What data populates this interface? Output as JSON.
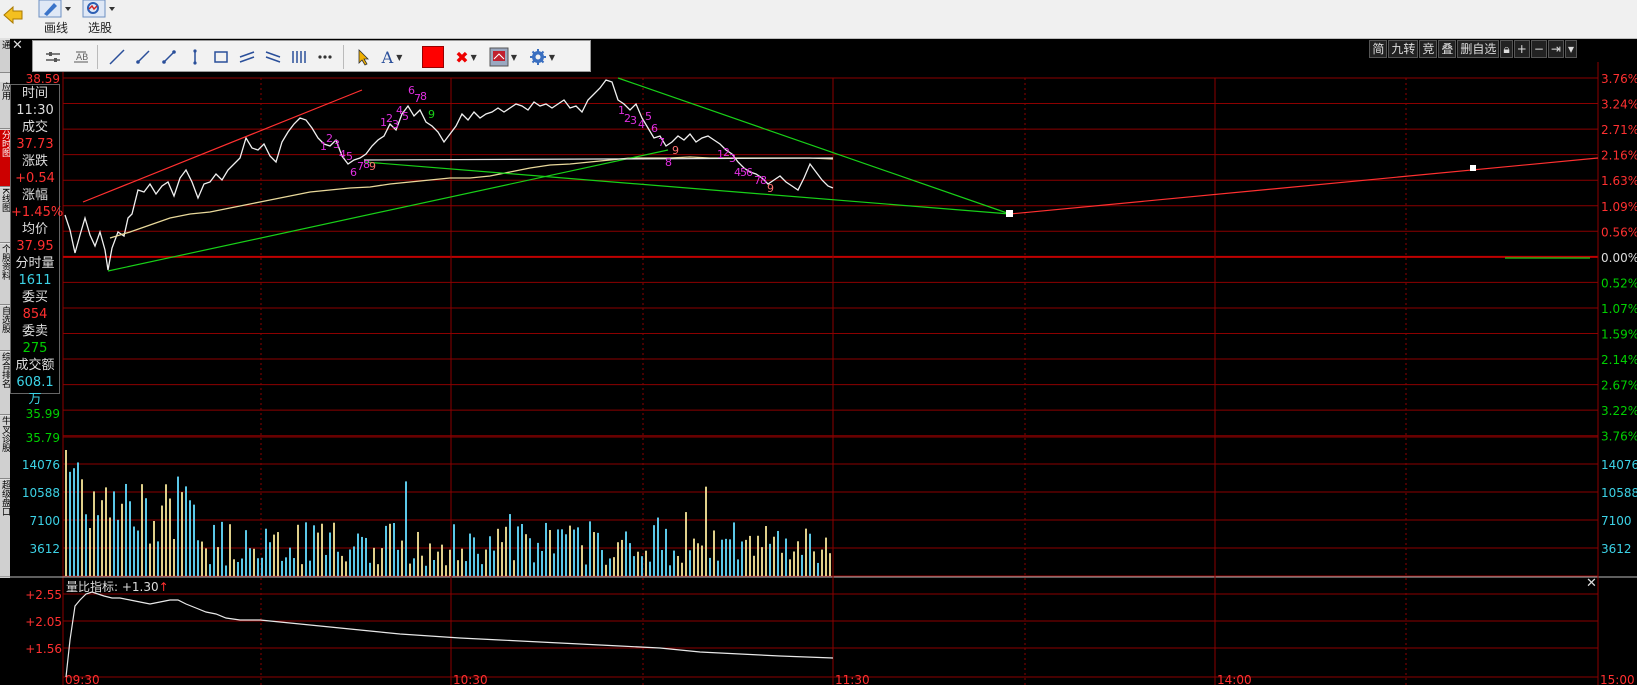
{
  "toolbar": {
    "draw_line_label": "画线",
    "stock_select_label": "选股"
  },
  "side_tabs": [
    "通",
    "应用",
    "分时图",
    "K线图",
    "个股资料",
    "自选股",
    "综合排名",
    "牛叉诊股",
    "超级盘口"
  ],
  "draw_tools": [
    "settings-icon",
    "text-style-icon",
    "line-icon",
    "ray-icon",
    "arrow-line-icon",
    "vertical-line-icon",
    "rectangle-icon",
    "parallel-lines-icon",
    "channel-icon",
    "fibonacci-icon",
    "more-icon",
    "pointer-icon",
    "text-icon",
    "color-swatch",
    "delete-icon",
    "display-icon",
    "gear-icon"
  ],
  "draw_tool_text": "A",
  "right_buttons": [
    "简",
    "九转",
    "竞",
    "叠",
    "删自选"
  ],
  "info_panel": {
    "time_label": "时间",
    "time_value": "11:30",
    "price_label": "成交",
    "price_value": "37.73",
    "change_label": "涨跌",
    "change_value": "+0.54",
    "change_pct_label": "涨幅",
    "change_pct_value": "+1.45%",
    "avg_label": "均价",
    "avg_value": "37.95",
    "minute_vol_label": "分时量",
    "minute_vol_value": "1611",
    "bid_label": "委买",
    "bid_value": "854",
    "ask_label": "委卖",
    "ask_value": "275",
    "amount_label": "成交额",
    "amount_value": "608.1万"
  },
  "indicator": {
    "label": "量比指标: +1.30",
    "arrow": "↑"
  },
  "colors": {
    "up": "#ff3030",
    "down": "#00d000",
    "grid": "#8b0000",
    "volume_blue": "#5bc8e8",
    "volume_yellow": "#e0d08a",
    "info_cyan": "#3cd2e6",
    "accent_red": "#ee0000"
  },
  "chart_data": {
    "type": "line",
    "price_axis_left": [
      "38.59",
      "35.99",
      "35.79"
    ],
    "pct_axis_right": [
      "3.76%",
      "3.24%",
      "2.71%",
      "2.16%",
      "1.63%",
      "1.09%",
      "0.56%",
      "0.00%",
      "0.52%",
      "1.07%",
      "1.59%",
      "2.14%",
      "2.67%",
      "3.22%",
      "3.76%"
    ],
    "volume_axis": [
      "14076",
      "10588",
      "7100",
      "3612"
    ],
    "indicator_axis": [
      "+2.55",
      "+2.05",
      "+1.56"
    ],
    "time_axis": [
      "09:30",
      "10:30",
      "11:30",
      "14:00",
      "15:00"
    ],
    "last_price": 37.73,
    "avg_price": 37.95
  }
}
